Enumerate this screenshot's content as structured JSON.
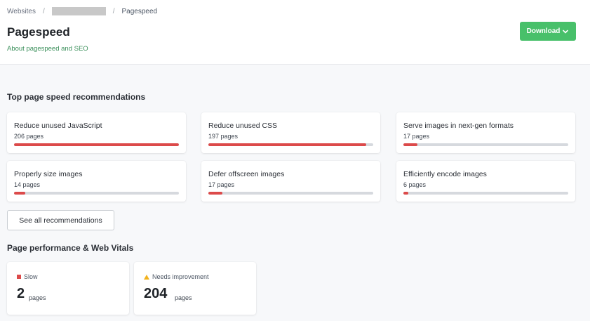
{
  "breadcrumb": {
    "root": "Websites",
    "separator": "/",
    "current": "Pagespeed"
  },
  "header": {
    "title": "Pagespeed",
    "about_link": "About pagespeed and SEO",
    "download_label": "Download"
  },
  "recommendations": {
    "section_title": "Top page speed recommendations",
    "items": [
      {
        "title": "Reduce unused JavaScript",
        "count": "206 pages",
        "fraction": 1.0
      },
      {
        "title": "Reduce unused CSS",
        "count": "197 pages",
        "fraction": 0.956
      },
      {
        "title": "Serve images in next-gen formats",
        "count": "17 pages",
        "fraction": 0.083
      },
      {
        "title": "Properly size images",
        "count": "14 pages",
        "fraction": 0.068
      },
      {
        "title": "Defer offscreen images",
        "count": "17 pages",
        "fraction": 0.083
      },
      {
        "title": "Efficiently encode images",
        "count": "6 pages",
        "fraction": 0.029
      }
    ],
    "see_all_label": "See all recommendations"
  },
  "vitals": {
    "section_title": "Page performance & Web Vitals",
    "cards": [
      {
        "label": "Slow",
        "value": "2",
        "unit": "pages",
        "indicator": "red-square-icon",
        "color": "#dc4a4a"
      },
      {
        "label": "Needs improvement",
        "value": "204",
        "unit": "pages",
        "indicator": "warning-triangle-icon",
        "color": "#f2b21c"
      }
    ]
  },
  "colors": {
    "accent_green": "#48c06a",
    "link_green": "#3a8f5a",
    "bar_red": "#dc4a4a",
    "bar_track": "#d6d9de"
  }
}
